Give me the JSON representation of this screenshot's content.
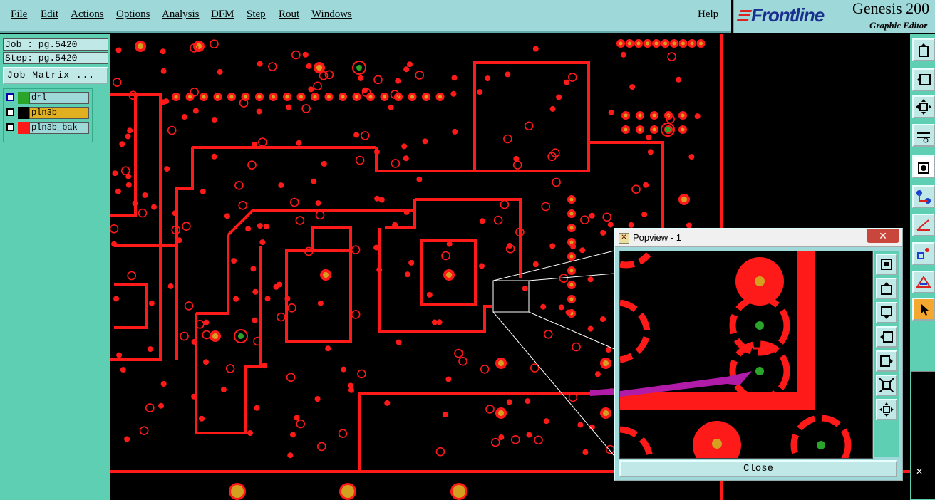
{
  "menu": {
    "items": [
      "File",
      "Edit",
      "Actions",
      "Options",
      "Analysis",
      "DFM",
      "Step",
      "Rout",
      "Windows"
    ],
    "help": "Help"
  },
  "brand": {
    "logo": "Frontline",
    "title": "Genesis 200",
    "subtitle": "Graphic Editor"
  },
  "job": {
    "job_label": "Job : pg.5420",
    "step_label": "Step: pg.5420",
    "matrix_button": "Job Matrix ..."
  },
  "layers": [
    {
      "name": "drl",
      "color": "#2aa52a",
      "label_bg": "#9ed8d8"
    },
    {
      "name": "pln3b",
      "color": "#000000",
      "label_bg": "#e0b020"
    },
    {
      "name": "pln3b_bak",
      "color": "#ff1a1a",
      "label_bg": "#9ed8d8"
    }
  ],
  "popview": {
    "title": "Popview - 1",
    "close_label": "Close",
    "close_x": "✕"
  },
  "toolbar": {
    "icons": [
      "window-up-icon",
      "window-left-icon",
      "fit-view-icon",
      "measure-icon",
      "select-mode-icon",
      "net-icon",
      "angle-icon",
      "feature-icon",
      "snap-icon",
      "pointer-icon"
    ]
  },
  "colors": {
    "copper": "#ff1a1a",
    "drill": "#2aa52a",
    "pad_center": "#d4a020",
    "panel": "#5ecfb3",
    "menubar": "#9ed8d8",
    "annotation": "#b01ca8"
  }
}
